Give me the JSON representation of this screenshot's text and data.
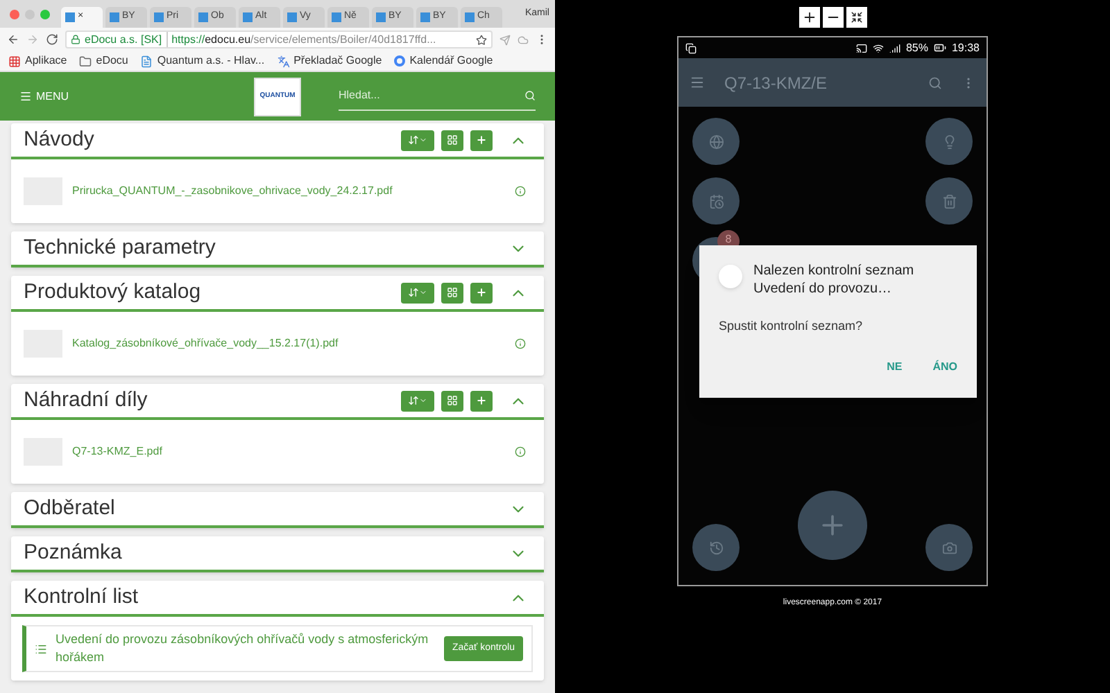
{
  "browser": {
    "tabs": [
      {
        "label": "×",
        "selected": true
      },
      {
        "label": "BY",
        "selected": false
      },
      {
        "label": "Pri",
        "selected": false
      },
      {
        "label": "Ob",
        "selected": false
      },
      {
        "label": "Alt",
        "selected": false
      },
      {
        "label": "Vy",
        "selected": false
      },
      {
        "label": "Ně",
        "selected": false
      },
      {
        "label": "BY",
        "selected": false
      },
      {
        "label": "BY",
        "selected": false
      },
      {
        "label": "Ch",
        "selected": false
      }
    ],
    "profile": "Kamil",
    "address": {
      "site": "eDocu a.s. [SK]",
      "scheme": "https://",
      "host": "edocu.eu",
      "path": "/service/elements/Boiler/40d1817ffd..."
    },
    "bookmarks": [
      {
        "label": "Aplikace",
        "kind": "apps"
      },
      {
        "label": "eDocu",
        "kind": "folder"
      },
      {
        "label": "Quantum a.s. - Hlav...",
        "kind": "page"
      },
      {
        "label": "Překladač Google",
        "kind": "translate"
      },
      {
        "label": "Kalendář Google",
        "kind": "google"
      }
    ]
  },
  "header": {
    "menu": "MENU",
    "logo": "QUANTUM",
    "search_placeholder": "Hledat..."
  },
  "sections": [
    {
      "title": "Návody",
      "expanded": true,
      "toolbar": true,
      "files": [
        "Prirucka_QUANTUM_-_zasobnikove_ohrivace_vody_24.2.17.pdf"
      ]
    },
    {
      "title": "Technické parametry",
      "expanded": false,
      "toolbar": false
    },
    {
      "title": "Produktový katalog",
      "expanded": true,
      "toolbar": true,
      "files": [
        "Katalog_zásobníkové_ohřívače_vody__15.2.17(1).pdf"
      ]
    },
    {
      "title": "Náhradní díly",
      "expanded": true,
      "toolbar": true,
      "files": [
        "Q7-13-KMZ_E.pdf"
      ]
    },
    {
      "title": "Odběratel",
      "expanded": false,
      "toolbar": false
    },
    {
      "title": "Poznámka",
      "expanded": false,
      "toolbar": false
    },
    {
      "title": "Kontrolní list",
      "expanded": true,
      "toolbar": false,
      "checklists": [
        {
          "text": "Uvedení do provozu zásobníkových ohřívačů vody s atmosferickým hořákem",
          "button": "Začať kontrolu"
        }
      ]
    }
  ],
  "phone": {
    "battery": "85%",
    "time": "19:38",
    "title": "Q7-13-KMZ/E",
    "badge": "8",
    "dialog": {
      "title": "Nalezen kontrolní seznam Uvedení do provozu…",
      "message": "Spustit kontrolní seznam?",
      "buttons": [
        "NE",
        "ÁNO"
      ]
    }
  },
  "footer": "livescreenapp.com © 2017"
}
